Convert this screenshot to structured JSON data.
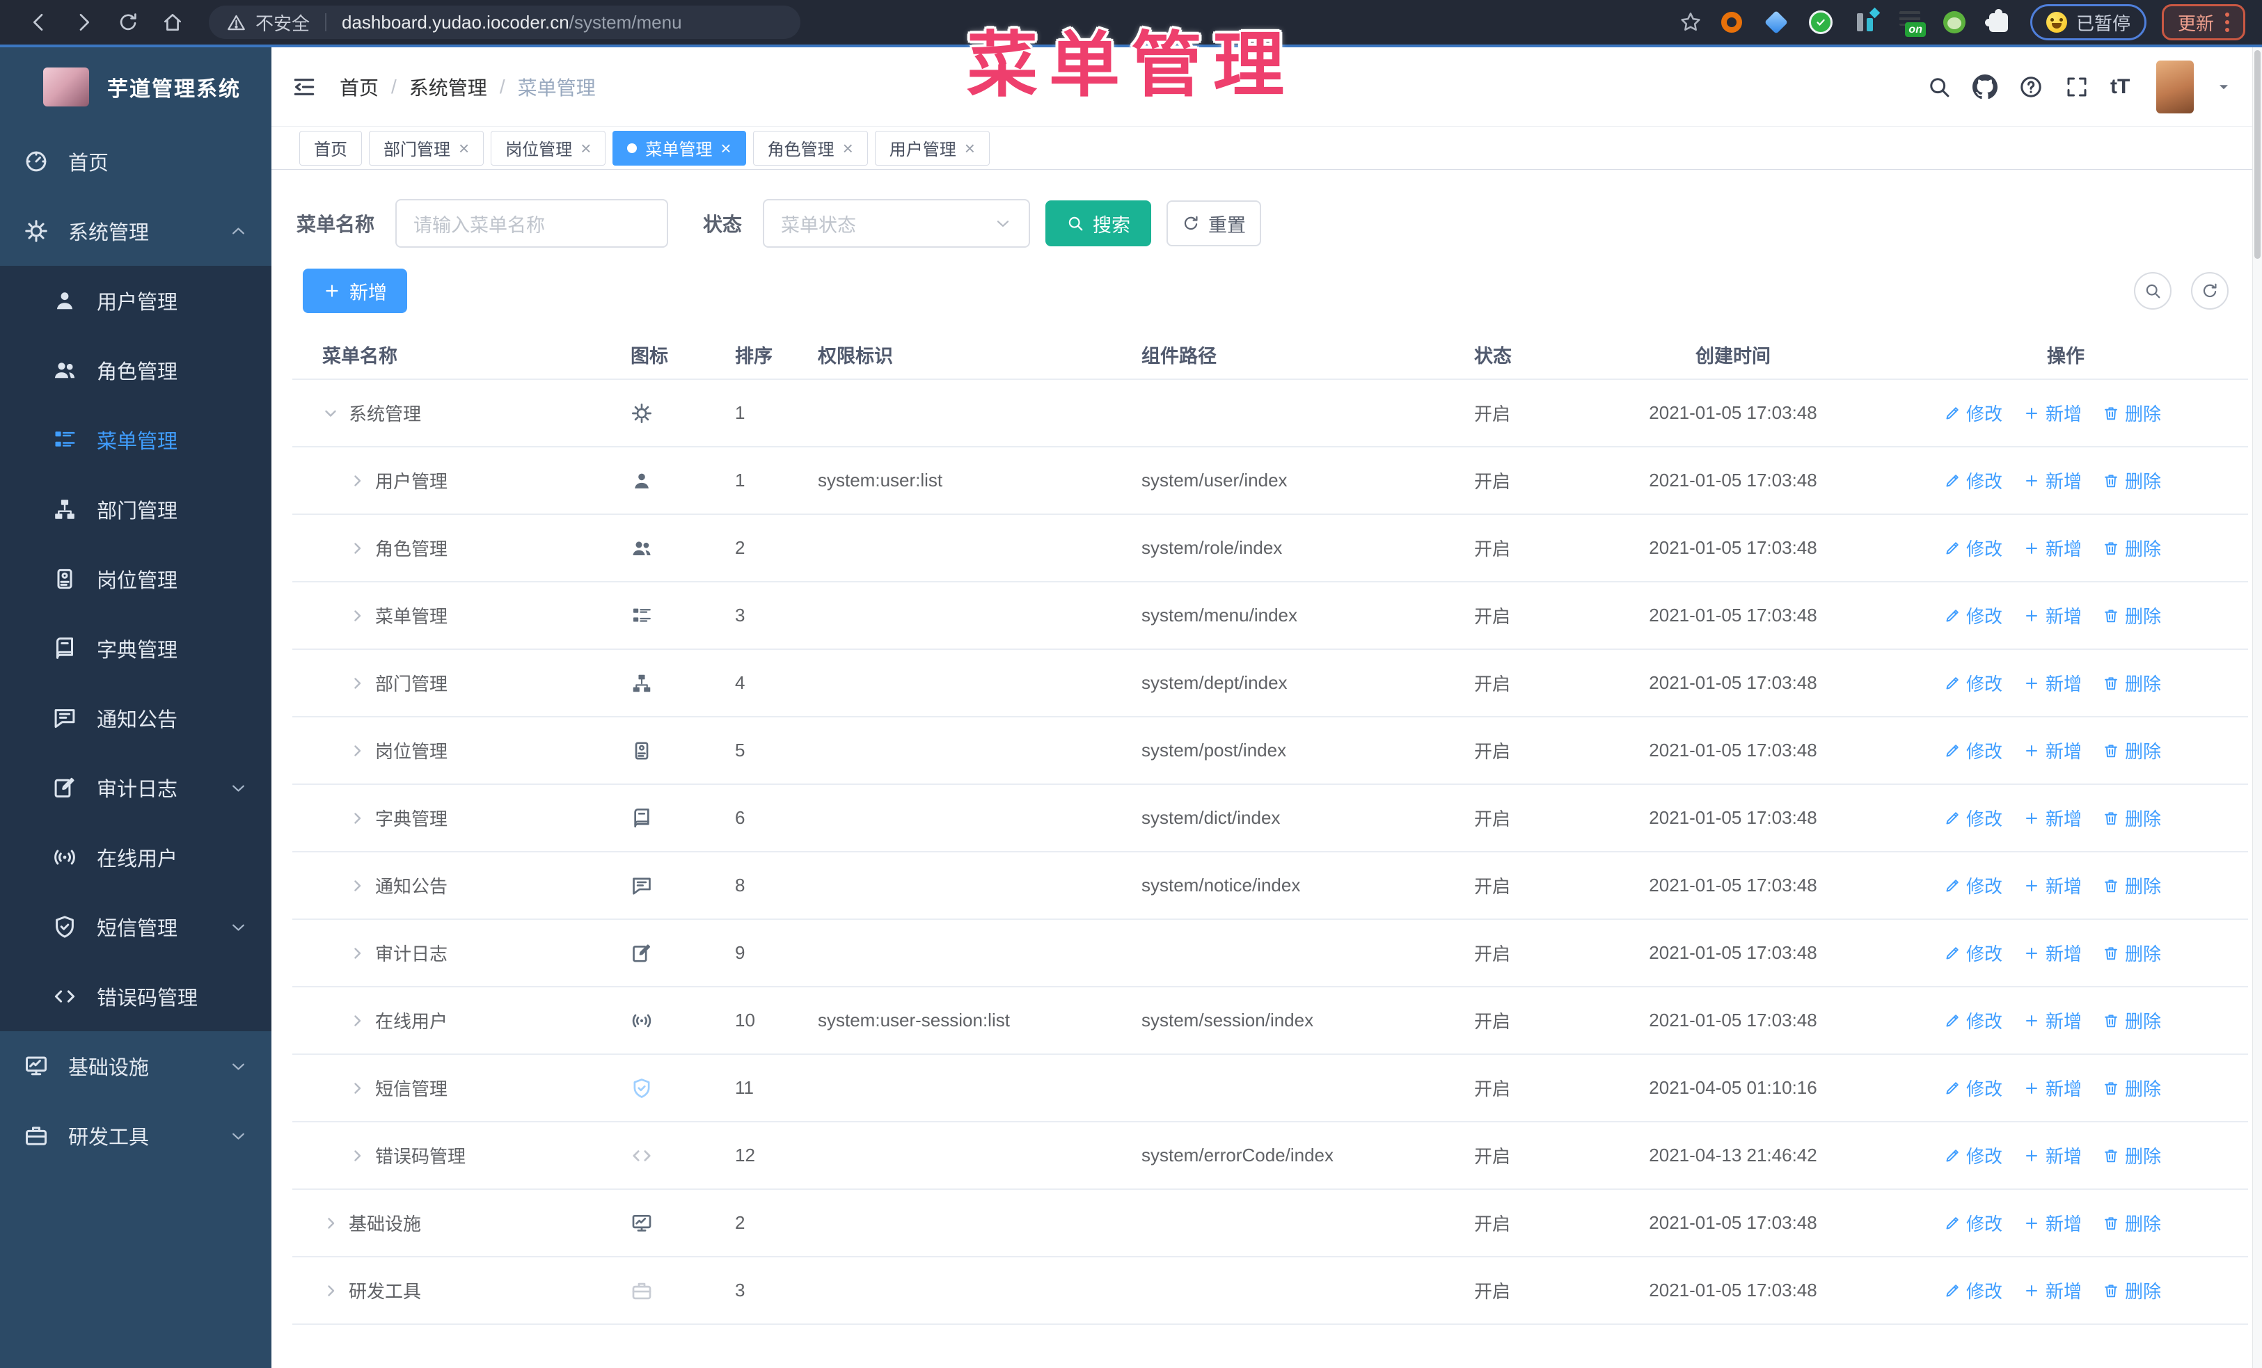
{
  "browser": {
    "security_label": "不安全",
    "url_host": "dashboard.yudao.iocoder.cn",
    "url_path": "/system/menu",
    "paused_label": "已暂停",
    "update_label": "更新",
    "extensions": [
      {
        "name": "extension-orange-ring"
      },
      {
        "name": "extension-blue-gem"
      },
      {
        "name": "extension-green-check"
      },
      {
        "name": "extension-cyan-bars"
      },
      {
        "name": "extension-on-badge",
        "label": "on"
      },
      {
        "name": "extension-green-monkey"
      },
      {
        "name": "extension-puzzle"
      }
    ]
  },
  "overlay_title": "菜单管理",
  "colors": {
    "accent": "#409eff",
    "search_button": "#1ab394",
    "overlay_pink": "#ee3f6d",
    "sidebar_bg": "#2c4a66",
    "sidebar_submenu_bg": "#223349"
  },
  "sidebar": {
    "logo_title": "芋道管理系统",
    "items": [
      {
        "label": "首页",
        "icon": "dashboard",
        "level": 0
      },
      {
        "label": "系统管理",
        "icon": "gear",
        "level": 0,
        "chevron": "up"
      },
      {
        "label": "用户管理",
        "icon": "user",
        "level": 1
      },
      {
        "label": "角色管理",
        "icon": "users",
        "level": 1
      },
      {
        "label": "菜单管理",
        "icon": "menu",
        "level": 1,
        "active": true
      },
      {
        "label": "部门管理",
        "icon": "tree",
        "level": 1
      },
      {
        "label": "岗位管理",
        "icon": "post",
        "level": 1
      },
      {
        "label": "字典管理",
        "icon": "dict",
        "level": 1
      },
      {
        "label": "通知公告",
        "icon": "notice",
        "level": 1
      },
      {
        "label": "审计日志",
        "icon": "log",
        "level": 1,
        "chevron": "down"
      },
      {
        "label": "在线用户",
        "icon": "online",
        "level": 1
      },
      {
        "label": "短信管理",
        "icon": "shield",
        "level": 1,
        "chevron": "down"
      },
      {
        "label": "错误码管理",
        "icon": "code",
        "level": 1
      },
      {
        "label": "基础设施",
        "icon": "monitor",
        "level": 0,
        "chevron": "down"
      },
      {
        "label": "研发工具",
        "icon": "toolbox",
        "level": 0,
        "chevron": "down"
      }
    ]
  },
  "breadcrumb": {
    "items": [
      "首页",
      "系统管理",
      "菜单管理"
    ]
  },
  "tabs": [
    {
      "label": "首页",
      "closable": false,
      "active": false
    },
    {
      "label": "部门管理",
      "closable": true,
      "active": false
    },
    {
      "label": "岗位管理",
      "closable": true,
      "active": false
    },
    {
      "label": "菜单管理",
      "closable": true,
      "active": true
    },
    {
      "label": "角色管理",
      "closable": true,
      "active": false
    },
    {
      "label": "用户管理",
      "closable": true,
      "active": false
    }
  ],
  "filter": {
    "name_label": "菜单名称",
    "name_placeholder": "请输入菜单名称",
    "status_label": "状态",
    "status_placeholder": "菜单状态",
    "search_label": "搜索",
    "reset_label": "重置"
  },
  "toolbar": {
    "add_label": "新增"
  },
  "table": {
    "columns": [
      "菜单名称",
      "图标",
      "排序",
      "权限标识",
      "组件路径",
      "状态",
      "创建时间",
      "操作"
    ],
    "action_labels": {
      "edit": "修改",
      "add": "新增",
      "delete": "删除"
    },
    "rows": [
      {
        "name": "系统管理",
        "icon": "gear",
        "level": 0,
        "expanded": true,
        "sort": "1",
        "perm": "",
        "path": "",
        "status": "开启",
        "time": "2021-01-05 17:03:48"
      },
      {
        "name": "用户管理",
        "icon": "user",
        "level": 1,
        "expanded": false,
        "sort": "1",
        "perm": "system:user:list",
        "path": "system/user/index",
        "status": "开启",
        "time": "2021-01-05 17:03:48"
      },
      {
        "name": "角色管理",
        "icon": "users",
        "level": 1,
        "expanded": false,
        "sort": "2",
        "perm": "",
        "path": "system/role/index",
        "status": "开启",
        "time": "2021-01-05 17:03:48"
      },
      {
        "name": "菜单管理",
        "icon": "menu",
        "level": 1,
        "expanded": false,
        "sort": "3",
        "perm": "",
        "path": "system/menu/index",
        "status": "开启",
        "time": "2021-01-05 17:03:48"
      },
      {
        "name": "部门管理",
        "icon": "tree",
        "level": 1,
        "expanded": false,
        "sort": "4",
        "perm": "",
        "path": "system/dept/index",
        "status": "开启",
        "time": "2021-01-05 17:03:48"
      },
      {
        "name": "岗位管理",
        "icon": "post",
        "level": 1,
        "expanded": false,
        "sort": "5",
        "perm": "",
        "path": "system/post/index",
        "status": "开启",
        "time": "2021-01-05 17:03:48"
      },
      {
        "name": "字典管理",
        "icon": "dict",
        "level": 1,
        "expanded": false,
        "sort": "6",
        "perm": "",
        "path": "system/dict/index",
        "status": "开启",
        "time": "2021-01-05 17:03:48"
      },
      {
        "name": "通知公告",
        "icon": "notice",
        "level": 1,
        "expanded": false,
        "sort": "8",
        "perm": "",
        "path": "system/notice/index",
        "status": "开启",
        "time": "2021-01-05 17:03:48"
      },
      {
        "name": "审计日志",
        "icon": "log",
        "level": 1,
        "expanded": false,
        "sort": "9",
        "perm": "",
        "path": "",
        "status": "开启",
        "time": "2021-01-05 17:03:48"
      },
      {
        "name": "在线用户",
        "icon": "online",
        "level": 1,
        "expanded": false,
        "sort": "10",
        "perm": "system:user-session:list",
        "path": "system/session/index",
        "status": "开启",
        "time": "2021-01-05 17:03:48"
      },
      {
        "name": "短信管理",
        "icon": "shield",
        "level": 1,
        "expanded": false,
        "sort": "11",
        "perm": "",
        "path": "",
        "status": "开启",
        "time": "2021-04-05 01:10:16",
        "icon_color": "#9ecfff"
      },
      {
        "name": "错误码管理",
        "icon": "code",
        "level": 1,
        "expanded": false,
        "sort": "12",
        "perm": "",
        "path": "system/errorCode/index",
        "status": "开启",
        "time": "2021-04-13 21:46:42",
        "icon_color": "#c0c4cc"
      },
      {
        "name": "基础设施",
        "icon": "monitor",
        "level": 0,
        "expanded": false,
        "sort": "2",
        "perm": "",
        "path": "",
        "status": "开启",
        "time": "2021-01-05 17:03:48"
      },
      {
        "name": "研发工具",
        "icon": "toolbox",
        "level": 0,
        "expanded": false,
        "sort": "3",
        "perm": "",
        "path": "",
        "status": "开启",
        "time": "2021-01-05 17:03:48",
        "icon_color": "#c8ccd4"
      }
    ]
  }
}
